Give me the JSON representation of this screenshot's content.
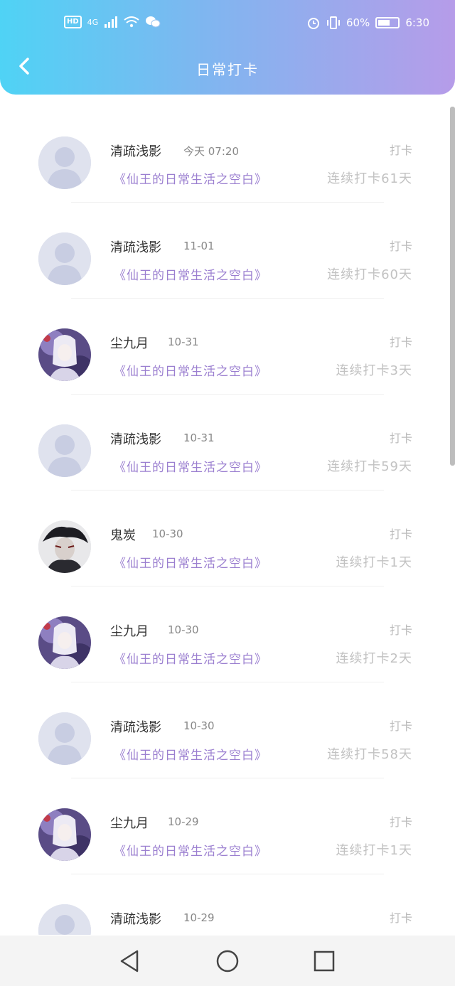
{
  "status": {
    "hd": "HD",
    "network": "4G",
    "battery_percent": "60%",
    "time": "6:30"
  },
  "header": {
    "title": "日常打卡",
    "back_icon": "chevron-left-icon"
  },
  "list": {
    "checkin_label": "打卡",
    "items": [
      {
        "name": "清疏浅影",
        "time": "今天 07:20",
        "book": "《仙王的日常生活之空白》",
        "streak": "连续打卡61天",
        "avatar": "default"
      },
      {
        "name": "清疏浅影",
        "time": "11-01",
        "book": "《仙王的日常生活之空白》",
        "streak": "连续打卡60天",
        "avatar": "default"
      },
      {
        "name": "尘九月",
        "time": "10-31",
        "book": "《仙王的日常生活之空白》",
        "streak": "连续打卡3天",
        "avatar": "anime-white"
      },
      {
        "name": "清疏浅影",
        "time": "10-31",
        "book": "《仙王的日常生活之空白》",
        "streak": "连续打卡59天",
        "avatar": "default"
      },
      {
        "name": "鬼炭",
        "time": "10-30",
        "book": "《仙王的日常生活之空白》",
        "streak": "连续打卡1天",
        "avatar": "anime-dark"
      },
      {
        "name": "尘九月",
        "time": "10-30",
        "book": "《仙王的日常生活之空白》",
        "streak": "连续打卡2天",
        "avatar": "anime-white"
      },
      {
        "name": "清疏浅影",
        "time": "10-30",
        "book": "《仙王的日常生活之空白》",
        "streak": "连续打卡58天",
        "avatar": "default"
      },
      {
        "name": "尘九月",
        "time": "10-29",
        "book": "《仙王的日常生活之空白》",
        "streak": "连续打卡1天",
        "avatar": "anime-white"
      },
      {
        "name": "清疏浅影",
        "time": "10-29",
        "book": "",
        "streak": "",
        "avatar": "default"
      }
    ]
  },
  "nav": {
    "back": "triangle-back-icon",
    "home": "circle-home-icon",
    "recent": "square-recents-icon"
  },
  "colors": {
    "header_start": "#4fd3f5",
    "header_end": "#b69ce9",
    "book_title": "#9b7fd0",
    "streak": "#c2c2c2"
  }
}
